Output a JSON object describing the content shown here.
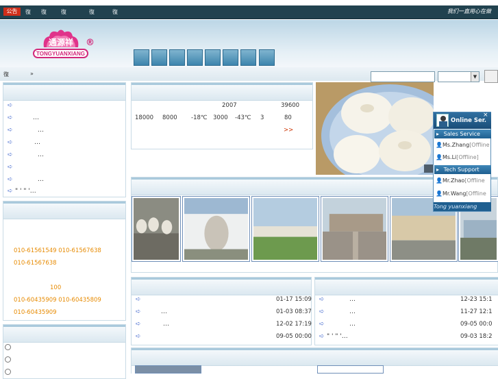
{
  "topbar": {
    "badge": "公告",
    "nav": [
      "復",
      "復",
      "復",
      "復",
      "復"
    ],
    "slogan": "我们一直用心在做"
  },
  "header": {
    "logo_cn": "通源祥",
    "logo_en": "TONGYUANXIANG",
    "registered": "®"
  },
  "breadcrumb": {
    "icon": "復",
    "sep": "»"
  },
  "search": {
    "select_arrow": "▼"
  },
  "products": {
    "items": [
      "",
      "…",
      "…",
      "…",
      "…",
      "",
      "…",
      "\" ' \" '…"
    ]
  },
  "contact": {
    "phone1": "010-61561549  010-61567638",
    "phone2": "010-61567638",
    "num100": "100",
    "phone3": "010-60435909  010-60435809",
    "phone4": "010-60435909"
  },
  "intro": {
    "row1": [
      "2007",
      "39600"
    ],
    "row2": [
      "18000",
      "8000",
      "-18℃",
      "3000",
      "-43℃",
      "3",
      "80"
    ],
    "more": ">>"
  },
  "news_left": [
    {
      "title": "",
      "date": "01-17 15:09"
    },
    {
      "title": "…",
      "date": "01-03 08:37"
    },
    {
      "title": "…",
      "date": "12-02 17:19"
    },
    {
      "title": "",
      "date": "09-05 00:00"
    }
  ],
  "news_right": [
    {
      "title": "…",
      "date": "12-23 15:1"
    },
    {
      "title": "…",
      "date": "11-27 12:1"
    },
    {
      "title": "…",
      "date": "09-05 00:0"
    },
    {
      "title": "\" ' \" '…",
      "date": "09-03 18:2"
    }
  ],
  "online": {
    "title": "Online Ser.",
    "close": "×",
    "sales_label": "Sales Service",
    "tech_label": "Tech Support",
    "people": [
      {
        "name": "Ms.Zhang",
        "status": "[Offline"
      },
      {
        "name": "Ms.Li",
        "status": "[Offline]"
      },
      {
        "name": "Mr.Zhao",
        "status": "[Offline"
      },
      {
        "name": "Mr.Wang",
        "status": "[Offline"
      }
    ],
    "footer": "Tong yuanxiang"
  },
  "colors": {
    "accent": "#21424f",
    "brand": "#d2287a",
    "link_orange": "#e78a00"
  }
}
